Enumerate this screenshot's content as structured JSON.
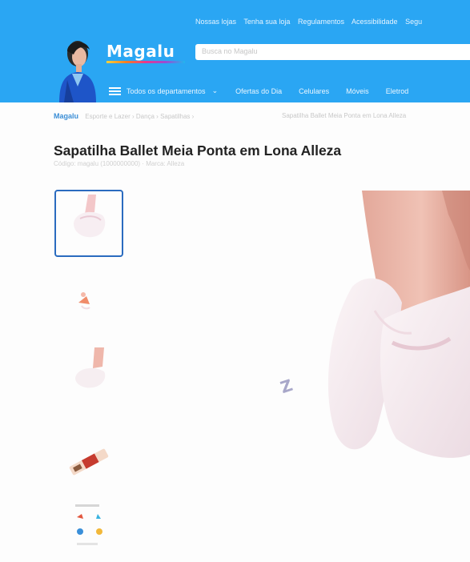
{
  "header": {
    "top_links": [
      "Nossas lojas",
      "Tenha sua loja",
      "Regulamentos",
      "Acessibilidade",
      "Segu"
    ],
    "logo": "Magalu",
    "search_placeholder": "Busca no Magalu",
    "nav": {
      "departments": "Todos os departamentos",
      "items": [
        "Ofertas do Dia",
        "Celulares",
        "Móveis",
        "Eletrod"
      ]
    }
  },
  "breadcrumb": {
    "home": "Magalu",
    "middle": "Esporte e Lazer  ›  Dança  ›  Sapatilhas  ›",
    "leaf": "Sapatilha Ballet Meia Ponta em Lona Alleza"
  },
  "product": {
    "title": "Sapatilha Ballet Meia Ponta em Lona Alleza",
    "subtitle": "Código: magalu  (1000000000)  ·  Marca: Alleza"
  },
  "colors": {
    "header": "#2aa6f3",
    "selected_thumb": "#2a6bbf"
  },
  "icons": [
    "menu-icon",
    "chevron-down-icon"
  ]
}
